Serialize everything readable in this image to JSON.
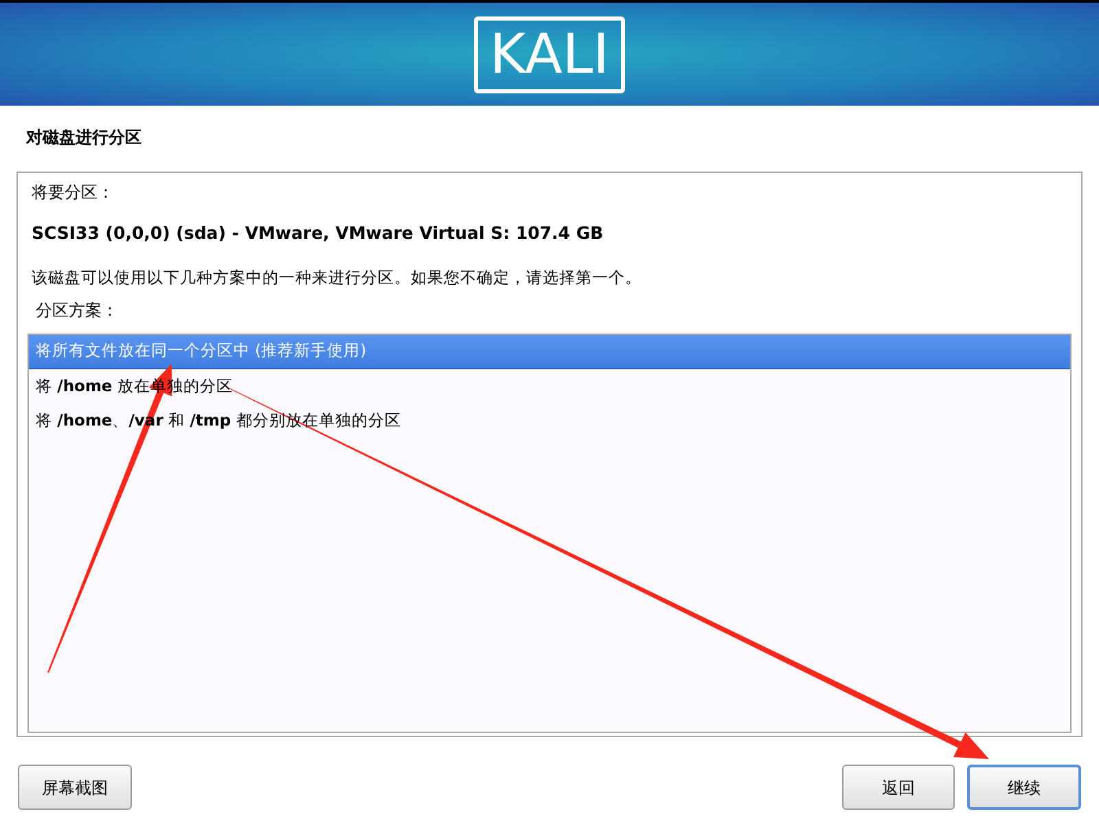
{
  "header": {
    "logo": "KALI"
  },
  "title": "对磁盘进行分区",
  "panel": {
    "intro": "将要分区：",
    "disk": "SCSI33 (0,0,0) (sda) - VMware, VMware Virtual S: 107.4 GB",
    "description": "该磁盘可以使用以下几种方案中的一种来进行分区。如果您不确定，请选择第一个。",
    "list_label": "分区方案：",
    "options": [
      {
        "label": "将所有文件放在同一个分区中 (推荐新手使用)",
        "selected": true
      },
      {
        "label": "将 **/home** 放在单独的分区",
        "selected": false
      },
      {
        "label": "将 **/home**、**/var** 和 **/tmp** 都分别放在单独的分区",
        "selected": false
      }
    ]
  },
  "buttons": [
    {
      "label": "屏幕截图",
      "focused": false
    },
    {
      "label": "返回",
      "focused": false
    },
    {
      "label": "继续",
      "focused": true
    }
  ]
}
